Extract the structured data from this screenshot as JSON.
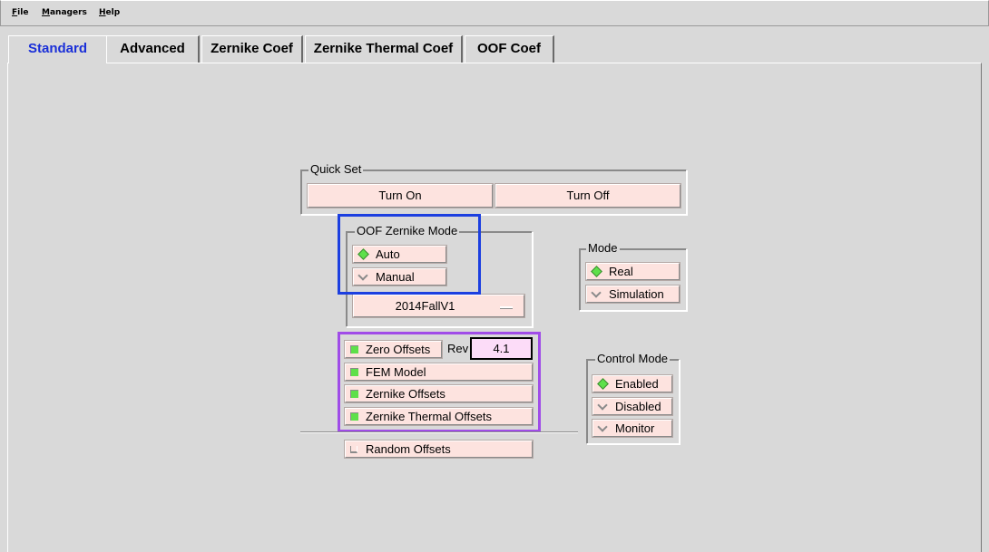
{
  "menu": {
    "file": "File",
    "managers": "Managers",
    "help": "Help"
  },
  "tabs": [
    "Standard",
    "Advanced",
    "Zernike Coef",
    "Zernike Thermal Coef",
    "OOF Coef"
  ],
  "quick_set": {
    "title": "Quick Set",
    "turn_on": "Turn On",
    "turn_off": "Turn Off"
  },
  "oof_mode": {
    "title": "OOF Zernike Mode",
    "auto": "Auto",
    "manual": "Manual",
    "model_selected": "2014FallV1"
  },
  "mode": {
    "title": "Mode",
    "real": "Real",
    "simulation": "Simulation"
  },
  "offsets": {
    "zero_offsets": "Zero Offsets",
    "rev_label": "Rev",
    "rev_value": "4.1",
    "fem_model": "FEM Model",
    "zernike_offsets": "Zernike Offsets",
    "zernike_thermal_offsets": "Zernike Thermal Offsets",
    "random_offsets": "Random Offsets"
  },
  "control_mode": {
    "title": "Control Mode",
    "enabled": "Enabled",
    "disabled": "Disabled",
    "monitor": "Monitor"
  },
  "colors": {
    "background": "#d9d9d9",
    "button_face": "#fde3df",
    "active_tab": "#1a2fd8",
    "indicator_on": "#5ee04a",
    "highlight_blue": "#1c3fe0",
    "highlight_purple": "#a04ce8",
    "rev_field": "#fcdcf8"
  }
}
